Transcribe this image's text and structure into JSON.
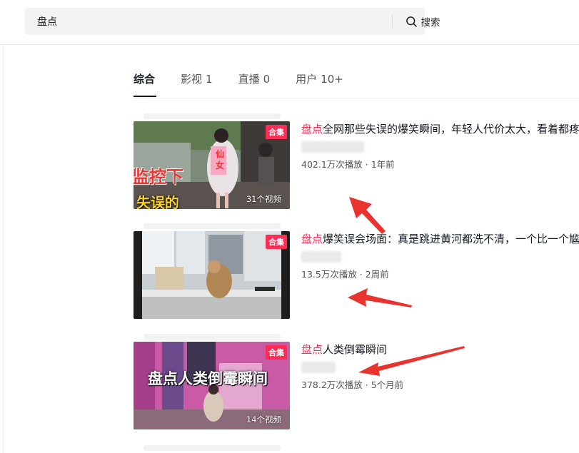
{
  "search": {
    "value": "盘点",
    "button_label": "搜索"
  },
  "tabs": [
    {
      "label": "综合",
      "count": ""
    },
    {
      "label": "影视",
      "count": "1"
    },
    {
      "label": "直播",
      "count": "0"
    },
    {
      "label": "用户",
      "count": "10+"
    }
  ],
  "results": [
    {
      "badge": "合集",
      "highlight": "盘点",
      "title_rest": "全网那些失误的爆笑瞬间，年轻人代价太大，看着都疼",
      "meta": "402.1万次播放 · 1年前",
      "video_count": "31个视频",
      "thumb_texts": [
        "监控下",
        "失误的",
        "仙女"
      ]
    },
    {
      "badge": "合集",
      "highlight": "盘点",
      "title_rest": "爆笑误会场面：真是跳进黄河都洗不清，一个比一个尴尬",
      "meta": "13.5万次播放 · 2周前",
      "video_count": "",
      "thumb_texts": []
    },
    {
      "badge": "合集",
      "highlight": "盘点",
      "title_rest": "人类倒霉瞬间",
      "meta": "378.2万次播放 · 5个月前",
      "video_count": "14个视频",
      "thumb_texts": [
        "盘点人类倒霉瞬间"
      ]
    }
  ],
  "colors": {
    "accent": "#fe2c55",
    "arrow": "#e8332f"
  }
}
